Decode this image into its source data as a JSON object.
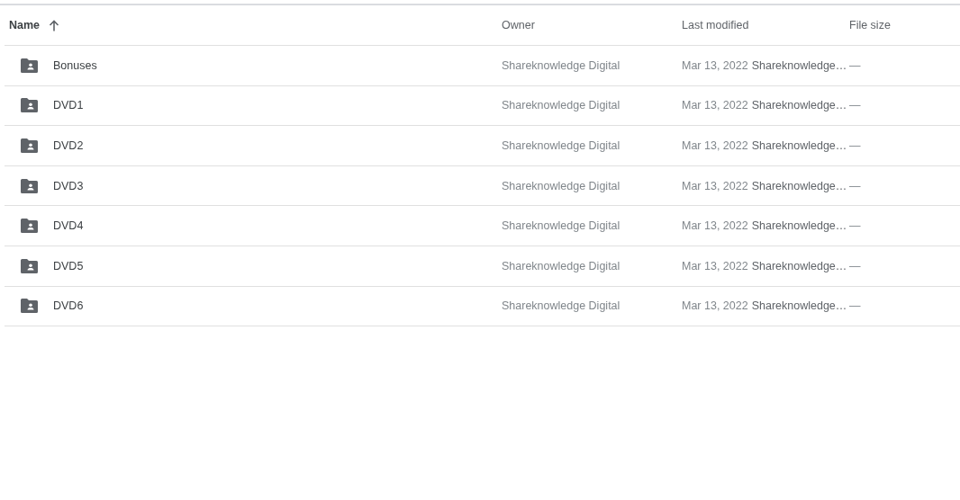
{
  "table": {
    "columns": [
      {
        "label": "Name",
        "sorted": true
      },
      {
        "label": "Owner",
        "sorted": false
      },
      {
        "label": "Last modified",
        "sorted": false
      },
      {
        "label": "File size",
        "sorted": false
      }
    ],
    "rows": [
      {
        "name": "Bonuses",
        "owner": "Shareknowledge Digital",
        "date": "Mar 13, 2022",
        "modified_by": "Shareknowledge…",
        "size": "—"
      },
      {
        "name": "DVD1",
        "owner": "Shareknowledge Digital",
        "date": "Mar 13, 2022",
        "modified_by": "Shareknowledge…",
        "size": "—"
      },
      {
        "name": "DVD2",
        "owner": "Shareknowledge Digital",
        "date": "Mar 13, 2022",
        "modified_by": "Shareknowledge…",
        "size": "—"
      },
      {
        "name": "DVD3",
        "owner": "Shareknowledge Digital",
        "date": "Mar 13, 2022",
        "modified_by": "Shareknowledge…",
        "size": "—"
      },
      {
        "name": "DVD4",
        "owner": "Shareknowledge Digital",
        "date": "Mar 13, 2022",
        "modified_by": "Shareknowledge…",
        "size": "—"
      },
      {
        "name": "DVD5",
        "owner": "Shareknowledge Digital",
        "date": "Mar 13, 2022",
        "modified_by": "Shareknowledge…",
        "size": "—"
      },
      {
        "name": "DVD6",
        "owner": "Shareknowledge Digital",
        "date": "Mar 13, 2022",
        "modified_by": "Shareknowledge…",
        "size": "—"
      }
    ]
  }
}
